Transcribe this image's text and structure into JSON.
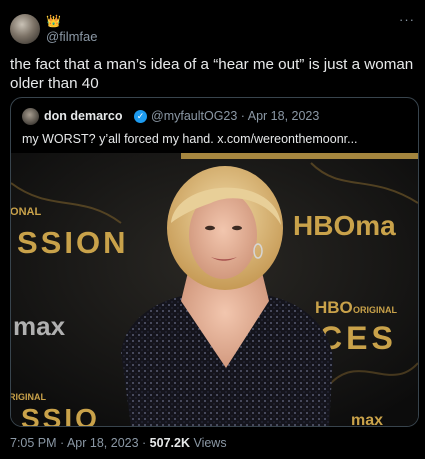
{
  "tweet": {
    "emoji": "👑",
    "handle": "@filmfae",
    "more_label": "···",
    "text": "the fact that a man’s idea of a “hear me out” is just a woman older than 40"
  },
  "quoted_tweet": {
    "display_name": "don demarco",
    "verified_mark": "✓",
    "meta": "@myfaultOG23 · Apr 18, 2023",
    "text": "my WORST? y’all forced my hand.  x.com/wereonthemoonr..."
  },
  "media": {
    "backdrop_texts": {
      "left_mid": "SSION",
      "left_upper": "IONAL",
      "left_lower": "max",
      "left_bottom_small": "RIGINAL",
      "left_bottom": "SSIO",
      "right_mid": "HBOma",
      "right_hbo": "HBO",
      "right_original": "ORIGINAL",
      "right_lower": "CES",
      "right_bottom": "max"
    },
    "colors": {
      "gold": "#c9a24a",
      "dress": "#15151f",
      "hair": "#e0c48a",
      "skin": "#e9b9a0"
    }
  },
  "footer": {
    "time": "7:05 PM · Apr 18, 2023 · ",
    "views_count": "507.2K",
    "views_label": " Views"
  }
}
